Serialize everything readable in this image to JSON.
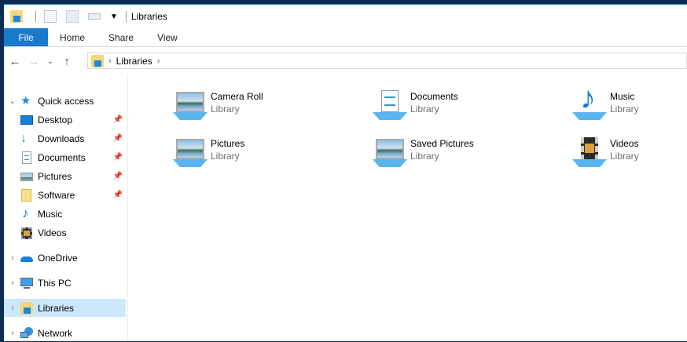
{
  "title": "Libraries",
  "ribbon": {
    "tabs": [
      "File",
      "Home",
      "Share",
      "View"
    ]
  },
  "address": {
    "crumbs": [
      "Libraries"
    ]
  },
  "nav": {
    "quick_access": "Quick access",
    "quick_items": [
      {
        "label": "Desktop",
        "icon": "desktop-icon",
        "pinned": true
      },
      {
        "label": "Downloads",
        "icon": "downloads-icon",
        "pinned": true
      },
      {
        "label": "Documents",
        "icon": "documents-icon",
        "pinned": true
      },
      {
        "label": "Pictures",
        "icon": "pictures-icon",
        "pinned": true
      },
      {
        "label": "Software",
        "icon": "folder-icon",
        "pinned": true
      },
      {
        "label": "Music",
        "icon": "music-icon",
        "pinned": false
      },
      {
        "label": "Videos",
        "icon": "videos-icon",
        "pinned": false
      }
    ],
    "roots": [
      "OneDrive",
      "This PC",
      "Libraries",
      "Network"
    ],
    "selected": "Libraries"
  },
  "libraries": [
    {
      "name": "Camera Roll",
      "type": "Library",
      "icon": "pictures"
    },
    {
      "name": "Documents",
      "type": "Library",
      "icon": "documents"
    },
    {
      "name": "Music",
      "type": "Library",
      "icon": "music"
    },
    {
      "name": "Pictures",
      "type": "Library",
      "icon": "pictures"
    },
    {
      "name": "Saved Pictures",
      "type": "Library",
      "icon": "pictures"
    },
    {
      "name": "Videos",
      "type": "Library",
      "icon": "videos"
    }
  ],
  "colors": {
    "accent": "#1979ca",
    "selection": "#cce8ff"
  }
}
